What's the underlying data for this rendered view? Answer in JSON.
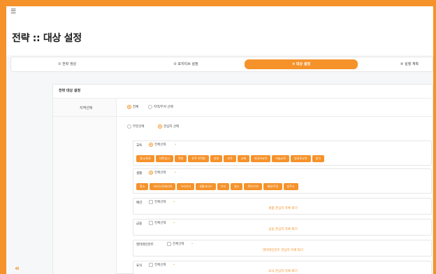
{
  "header": {
    "menu_icon": "menu-icon",
    "title": "전략 :: 대상 설정"
  },
  "steps": [
    {
      "label": "① 전략 생성",
      "active": false
    },
    {
      "label": "② 포지티브 설정",
      "active": false
    },
    {
      "label": "③ 대상 설정",
      "active": true
    },
    {
      "label": "④ 실행 계획",
      "active": false
    }
  ],
  "card": {
    "title": "전략 대상 설정",
    "scope_label": "지역선택",
    "scope_options": [
      {
        "label": "전체",
        "checked": true
      },
      {
        "label": "지역/부서 선택",
        "checked": false
      }
    ],
    "mode_options": [
      {
        "label": "부분선택",
        "checked": false
      },
      {
        "label": "관심지 선택",
        "checked": true
      }
    ],
    "groups": [
      {
        "name": "교육",
        "all_label": "전체선택",
        "all_checked": true,
        "chips": [
          "정시/완료",
          "대학입시",
          "학원",
          "유학 어학원",
          "과외",
          "자격",
          "교재",
          "외국어교육",
          "미술교육",
          "방과후교육",
          "음악"
        ]
      },
      {
        "name": "생활",
        "all_label": "전체선택",
        "all_checked": true,
        "chips": [
          "홈쇼",
          "오피스/인테리어",
          "수리기사",
          "생활서비스",
          "이사",
          "청소",
          "육아/키즈",
          "배달/주문",
          "청주시"
        ]
      },
      {
        "name": "패션",
        "all_label": "전체선택",
        "all_checked": false,
        "empty_text": "세품 관심지 목록 펴기"
      },
      {
        "name": "금융",
        "all_label": "전체선택",
        "all_checked": false,
        "empty_text": "금융 관심지 목록 펴기"
      },
      {
        "name": "엔터테인먼트",
        "all_label": "전체선택",
        "all_checked": false,
        "empty_text": "엔터테인먼트 관심지 목록 펴기"
      },
      {
        "name": "요식",
        "all_label": "전체선택",
        "all_checked": false,
        "empty_text": "요식 관심지 목록 펴기"
      }
    ]
  },
  "sidebar": {
    "collapse_icon": "double-chevron-left-icon",
    "collapse_glyph": "«"
  },
  "colors": {
    "accent": "#f5922a",
    "background": "#f6f7f9",
    "card": "#ffffff"
  }
}
